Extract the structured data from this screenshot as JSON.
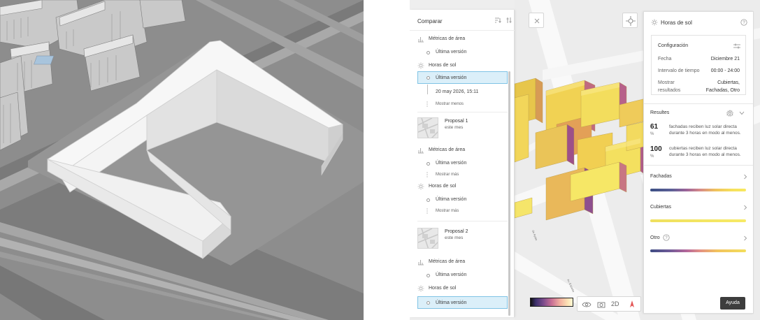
{
  "compare_panel": {
    "title": "Comparar",
    "items": {
      "metricas_1": "Métricas de área",
      "ultima_1": "Última versión",
      "horas_1": "Horas de sol",
      "ultima_sel": "Última versión",
      "timestamp": "20 may 2026, 15:11",
      "mostrar_menos": "Mostrar menos",
      "proposal1_name": "Proposal 1",
      "proposal1_sub": "este mes",
      "metricas_2": "Métricas de área",
      "ultima_2": "Última versión",
      "mostrar_mas_1": "Mostrar más",
      "horas_2": "Horas de sol",
      "ultima_3": "Última versión",
      "mostrar_mas_2": "Mostrar más",
      "proposal2_name": "Proposal 2",
      "proposal2_sub": "este mes",
      "metricas_3": "Métricas de área",
      "ultima_4": "Última versión",
      "horas_3": "Horas de sol",
      "ultima_sel2": "Última versión"
    }
  },
  "map": {
    "toolbar_2d": "2D"
  },
  "sun_panel": {
    "title": "Horas de sol",
    "config_title": "Configuración",
    "fecha_label": "Fecha",
    "fecha_value": "Diciembre 21",
    "intervalo_label": "Intervalo de tiempo",
    "intervalo_value": "00:00 - 24:00",
    "mostrar_label": "Mostrar",
    "resultados_label": "resultados",
    "mostrar_value_1": "Cubiertas,",
    "mostrar_value_2": "Fachadas, Otro",
    "results_title": "Resultes",
    "r1_num": "61",
    "r1_pct": "%",
    "r1_text": "fachadas reciben luz solar directa durante 3 horas en modo al menos.",
    "r2_num": "100",
    "r2_pct": "%",
    "r2_text": "cubiertas reciben luz solar directa durante 3 horas en modo al menos.",
    "cat_fachadas": "Fachadas",
    "cat_cubiertas": "Cubiertas",
    "cat_otro": "Otro"
  },
  "help_button": "Ayuda",
  "colors": {
    "selection_bg": "#dbeff9",
    "selection_border": "#7fc3e5",
    "heat_low": "#3b3f7a",
    "heat_mid": "#c2608f",
    "heat_high": "#f6e45a"
  },
  "icons": [
    "sort-icon",
    "filter-icon",
    "bar-chart-icon",
    "sun-icon",
    "circle-icon",
    "close-icon",
    "compass-icon",
    "eye-icon",
    "camera-icon",
    "north-arrow-icon",
    "help-circle-icon",
    "sliders-icon",
    "gear-icon",
    "chevron-down-icon",
    "chevron-right-icon"
  ]
}
